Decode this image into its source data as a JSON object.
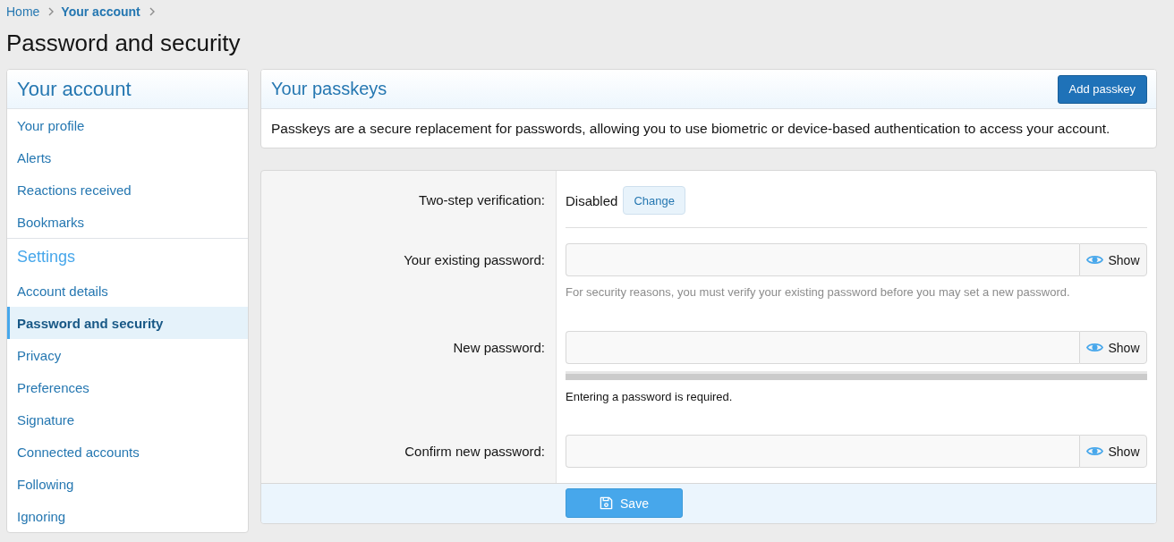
{
  "breadcrumb": [
    {
      "label": "Home",
      "current": false
    },
    {
      "label": "Your account",
      "current": true
    }
  ],
  "page_title": "Password and security",
  "sidebar": {
    "title": "Your account",
    "sections": [
      {
        "items": [
          {
            "label": "Your profile",
            "selected": false
          },
          {
            "label": "Alerts",
            "selected": false
          },
          {
            "label": "Reactions received",
            "selected": false
          },
          {
            "label": "Bookmarks",
            "selected": false
          }
        ]
      },
      {
        "heading": "Settings",
        "items": [
          {
            "label": "Account details",
            "selected": false
          },
          {
            "label": "Password and security",
            "selected": true
          },
          {
            "label": "Privacy",
            "selected": false
          },
          {
            "label": "Preferences",
            "selected": false
          },
          {
            "label": "Signature",
            "selected": false
          },
          {
            "label": "Connected accounts",
            "selected": false
          },
          {
            "label": "Following",
            "selected": false
          },
          {
            "label": "Ignoring",
            "selected": false
          }
        ]
      }
    ]
  },
  "passkeys": {
    "title": "Your passkeys",
    "button": "Add passkey",
    "description": "Passkeys are a secure replacement for passwords, allowing you to use biometric or device-based authentication to access your account."
  },
  "form": {
    "rows": [
      {
        "kind": "status",
        "label": "Two-step verification:",
        "value": "Disabled",
        "button": "Change"
      },
      {
        "kind": "password",
        "label": "Your existing password:",
        "toggle": "Show",
        "hint": "For security reasons, you must verify your existing password before you may set a new password."
      },
      {
        "kind": "password",
        "label": "New password:",
        "toggle": "Show",
        "meter": {
          "level": 0
        },
        "message": "Entering a password is required."
      },
      {
        "kind": "password",
        "label": "Confirm new password:",
        "toggle": "Show"
      }
    ],
    "submit": "Save"
  }
}
